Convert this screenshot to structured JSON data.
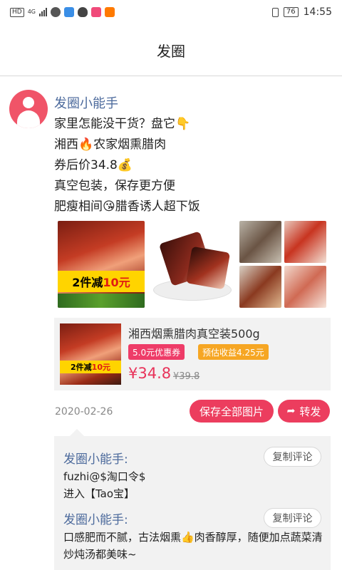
{
  "status_bar": {
    "network": "HD",
    "signal_gen": "4G",
    "battery": "76",
    "time": "14:55"
  },
  "header": {
    "title": "发圈"
  },
  "post": {
    "author": "发圈小能手",
    "lines": [
      "家里怎能没干货？盘它👇",
      "湘西🔥农家烟熏腊肉",
      "券后价34.8💰",
      "真空包装，保存更方便",
      "肥瘦相间😘腊香诱人超下饭"
    ],
    "image_banner_prefix": "2件减",
    "image_banner_num": "10元",
    "date": "2020-02-26",
    "save_all_label": "保存全部图片",
    "share_label": "转发"
  },
  "product": {
    "title": "湘西烟熏腊肉真空装500g",
    "coupon": "5.0元优惠券",
    "earnings": "预估收益4.25元",
    "price": "¥34.8",
    "original_price": "¥39.8",
    "thumb_banner_prefix": "2件减",
    "thumb_banner_num": "10元"
  },
  "comments": [
    {
      "author": "发圈小能手:",
      "text_lines": [
        "fuzhi@$淘口令$",
        "进入【Tao宝】"
      ],
      "copy_label": "复制评论"
    },
    {
      "author": "发圈小能手:",
      "text_lines": [
        "口感肥而不腻，古法烟熏👍肉香醇厚，随便加点蔬菜清炒炖汤都美味~"
      ],
      "copy_label": "复制评论"
    }
  ],
  "colors": {
    "accent": "#ec3d5e",
    "author_blue": "#4c6a9c",
    "coupon_pink": "#ee3c68",
    "earn_orange": "#f6a623",
    "price_red": "#e8335a"
  }
}
